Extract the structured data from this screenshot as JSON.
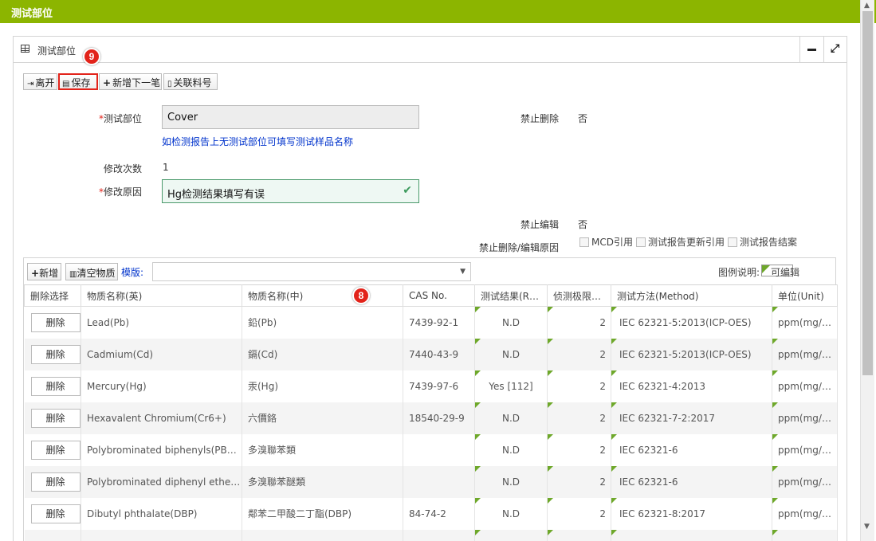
{
  "window": {
    "title": "测试部位"
  },
  "panel": {
    "title": "测试部位"
  },
  "badges": {
    "save_badge": "9",
    "table_badge": "8"
  },
  "toolbar": {
    "leave": "离开",
    "save": "保存",
    "add_next": "新增下一笔",
    "link_material": "关联料号"
  },
  "form": {
    "test_part_label": "测试部位",
    "test_part_value": "Cover",
    "test_part_hint": "如检测报告上无测试部位可填写测试样品名称",
    "modify_count_label": "修改次数",
    "modify_count_value": "1",
    "modify_reason_label": "修改原因",
    "modify_reason_value": "Hg检测结果填写有误",
    "forbid_delete_label": "禁止删除",
    "forbid_delete_value": "否",
    "forbid_edit_label": "禁止编辑",
    "forbid_edit_value": "否",
    "forbid_reason_label": "禁止删除/编辑原因",
    "cb_mcd": "MCD引用",
    "cb_report_update": "测试报告更新引用",
    "cb_report_close": "测试报告结案"
  },
  "substances": {
    "add": "新增",
    "clear": "清空物质",
    "template_label": "模版:",
    "legend_label": "图例说明:",
    "legend_editable": "可编辑",
    "columns": [
      "删除选择",
      "物质名称(英)",
      "物质名称(中)",
      "CAS No.",
      "测试结果(R…",
      "侦测极限…",
      "测试方法(Method)",
      "单位(Unit)"
    ],
    "delete_label": "删除",
    "rows": [
      {
        "en": "Lead(Pb)",
        "cn": "鉛(Pb)",
        "cas": "7439-92-1",
        "result": "N.D",
        "limit": "2",
        "method": "IEC 62321-5:2013(ICP-OES)",
        "unit": "ppm(mg/kg)"
      },
      {
        "en": "Cadmium(Cd)",
        "cn": "鎘(Cd)",
        "cas": "7440-43-9",
        "result": "N.D",
        "limit": "2",
        "method": "IEC 62321-5:2013(ICP-OES)",
        "unit": "ppm(mg/kg)"
      },
      {
        "en": "Mercury(Hg)",
        "cn": "汞(Hg)",
        "cas": "7439-97-6",
        "result": "Yes [112]",
        "limit": "2",
        "method": "IEC 62321-4:2013",
        "unit": "ppm(mg/kg)"
      },
      {
        "en": "Hexavalent Chromium(Cr6+)",
        "cn": "六價鉻",
        "cas": "18540-29-9",
        "result": "N.D",
        "limit": "2",
        "method": "IEC 62321-7-2:2017",
        "unit": "ppm(mg/kg)"
      },
      {
        "en": "Polybrominated biphenyls(PBBs)",
        "cn": "多溴聯苯類",
        "cas": "",
        "result": "N.D",
        "limit": "2",
        "method": "IEC 62321-6",
        "unit": "ppm(mg/kg)"
      },
      {
        "en": "Polybrominated diphenyl ethers(…",
        "cn": "多溴聯苯醚類",
        "cas": "",
        "result": "N.D",
        "limit": "2",
        "method": "IEC 62321-6",
        "unit": "ppm(mg/kg)"
      },
      {
        "en": "Dibutyl phthalate(DBP)",
        "cn": "鄰苯二甲酸二丁酯(DBP)",
        "cas": "84-74-2",
        "result": "N.D",
        "limit": "2",
        "method": "IEC 62321-8:2017",
        "unit": "ppm(mg/kg)"
      }
    ]
  }
}
